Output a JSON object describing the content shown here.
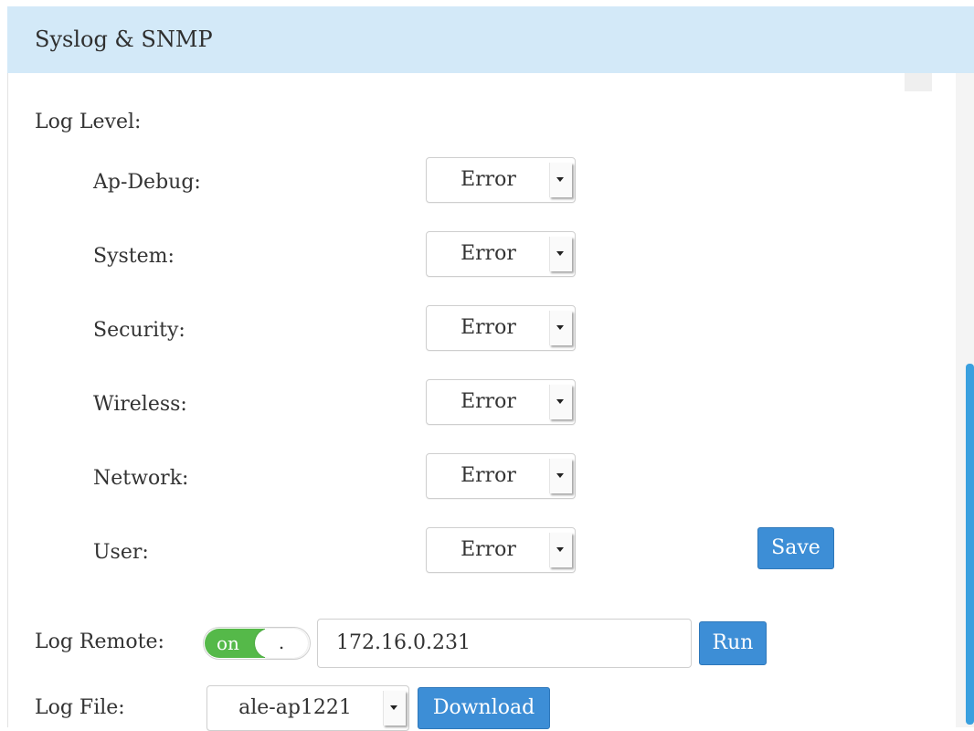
{
  "header": {
    "title": "Syslog & SNMP"
  },
  "log_level": {
    "label": "Log Level:",
    "rows": [
      {
        "label": "Ap-Debug:",
        "value": "Error"
      },
      {
        "label": "System:",
        "value": "Error"
      },
      {
        "label": "Security:",
        "value": "Error"
      },
      {
        "label": "Wireless:",
        "value": "Error"
      },
      {
        "label": "Network:",
        "value": "Error"
      },
      {
        "label": "User:",
        "value": "Error"
      }
    ],
    "save_label": "Save"
  },
  "log_remote": {
    "label": "Log Remote:",
    "toggle_on": "on",
    "toggle_knob": ".",
    "value": "172.16.0.231",
    "run_label": "Run"
  },
  "log_file": {
    "label": "Log File:",
    "value": "ale-ap1221",
    "download_label": "Download"
  },
  "colors": {
    "header_bg": "#d3e9f8",
    "button": "#3d8ed6",
    "toggle_on": "#55b949",
    "scrollbar": "#3aa0df"
  }
}
